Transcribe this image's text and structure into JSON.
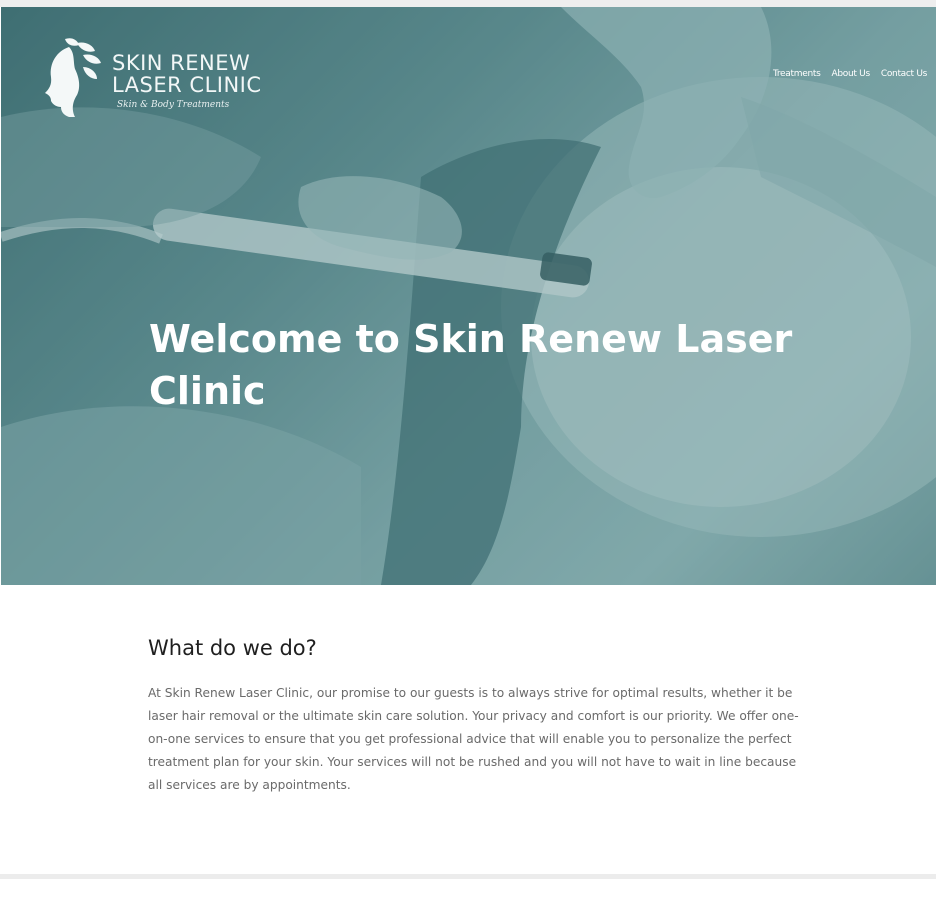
{
  "logo": {
    "line1": "SKIN RENEW",
    "line2": "LASER CLINIC",
    "tagline": "Skin & Body Treatments"
  },
  "nav": {
    "items": [
      {
        "label": "Treatments"
      },
      {
        "label": "About Us"
      },
      {
        "label": "Contact Us"
      }
    ]
  },
  "hero": {
    "title": "Welcome to Skin Renew Laser Clinic"
  },
  "section": {
    "title": "What do we do?",
    "body": "At Skin Renew Laser Clinic, our promise to our guests is to always strive for optimal results, whether it be laser hair removal or the ultimate skin care solution. Your privacy and comfort is our priority. We offer one-on-one services to ensure that you get professional advice that will enable you to personalize the perfect treatment plan for your skin. Your services will not be rushed and you will not have to wait in line because all services are by appointments."
  },
  "colors": {
    "hero_tint": "#5c8a8d",
    "heading": "#1f1f1f",
    "body_text": "#6a6a6a",
    "nav_text": "#ffffff"
  },
  "icons": {
    "logo_mark": "woman-profile-leaves-icon"
  }
}
